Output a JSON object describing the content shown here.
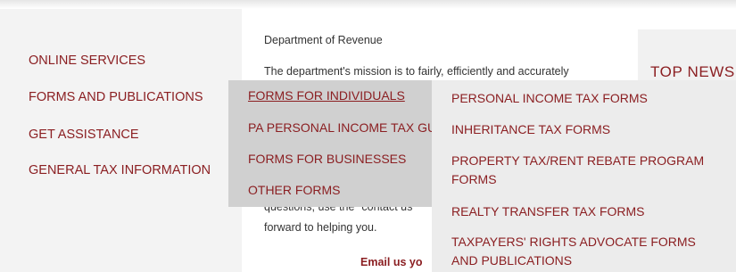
{
  "sidebar": {
    "items": [
      {
        "label": "ONLINE SERVICES"
      },
      {
        "label": "FORMS AND PUBLICATIONS"
      },
      {
        "label": "GET ASSISTANCE"
      },
      {
        "label": "GENERAL TAX INFORMATION"
      }
    ]
  },
  "content": {
    "heading": "Department of Revenue",
    "mission": "The department's mission is to fairly, efficiently and accurately",
    "questions": "questions, use the \"contact us",
    "forward": "forward to helping you.",
    "email_label": "Email us yo"
  },
  "news": {
    "title": "TOP NEWS"
  },
  "forms_menu": {
    "items": [
      {
        "label": "FORMS FOR INDIVIDUALS"
      },
      {
        "label": "PA PERSONAL INCOME TAX GUIDE"
      },
      {
        "label": "FORMS FOR BUSINESSES"
      },
      {
        "label": "OTHER FORMS"
      }
    ]
  },
  "individual_forms_menu": {
    "items": [
      {
        "label": "PERSONAL INCOME TAX FORMS"
      },
      {
        "label": "INHERITANCE TAX FORMS"
      },
      {
        "label": "PROPERTY TAX/RENT REBATE PROGRAM FORMS"
      },
      {
        "label": "REALTY TRANSFER TAX FORMS"
      },
      {
        "label": "TAXPAYERS' RIGHTS ADVOCATE FORMS AND PUBLICATIONS"
      }
    ]
  },
  "colors": {
    "link": "#8b1f22",
    "sidebar_bg": "#f3f3f3",
    "menu1_bg": "#d0d0d0",
    "menu2_bg": "#ececec"
  }
}
